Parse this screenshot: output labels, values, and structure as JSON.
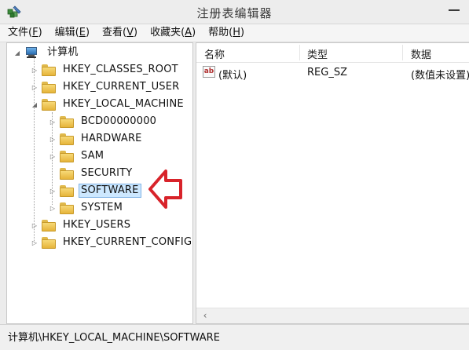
{
  "window": {
    "title": "注册表编辑器",
    "minimize_icon": "minimize-icon",
    "app_icon": "registry-editor-icon"
  },
  "menu": [
    {
      "label": "文件(",
      "accel": "F",
      "tail": ")"
    },
    {
      "label": "编辑(",
      "accel": "E",
      "tail": ")"
    },
    {
      "label": "查看(",
      "accel": "V",
      "tail": ")"
    },
    {
      "label": "收藏夹(",
      "accel": "A",
      "tail": ")"
    },
    {
      "label": "帮助(",
      "accel": "H",
      "tail": ")"
    }
  ],
  "tree": {
    "root": "计算机",
    "hives": [
      {
        "label": "HKEY_CLASSES_ROOT",
        "expanded": false
      },
      {
        "label": "HKEY_CURRENT_USER",
        "expanded": false
      },
      {
        "label": "HKEY_LOCAL_MACHINE",
        "expanded": true
      },
      {
        "label": "HKEY_USERS",
        "expanded": false
      },
      {
        "label": "HKEY_CURRENT_CONFIG",
        "expanded": false
      }
    ],
    "hklm_children": [
      {
        "label": "BCD00000000",
        "has_children": true
      },
      {
        "label": "HARDWARE",
        "has_children": true
      },
      {
        "label": "SAM",
        "has_children": true
      },
      {
        "label": "SECURITY",
        "has_children": false
      },
      {
        "label": "SOFTWARE",
        "has_children": true,
        "selected": true
      },
      {
        "label": "SYSTEM",
        "has_children": true
      }
    ]
  },
  "list": {
    "columns": [
      "名称",
      "类型",
      "数据"
    ],
    "rows": [
      {
        "icon": "string-value-icon",
        "icon_text": "ab",
        "name": "(默认)",
        "type": "REG_SZ",
        "data": "(数值未设置)"
      }
    ]
  },
  "status": {
    "path": "计算机\\HKEY_LOCAL_MACHINE\\SOFTWARE"
  },
  "colors": {
    "selection": "#cde8ff",
    "arrow": "#d8232a",
    "folder": "#f0c95a"
  }
}
